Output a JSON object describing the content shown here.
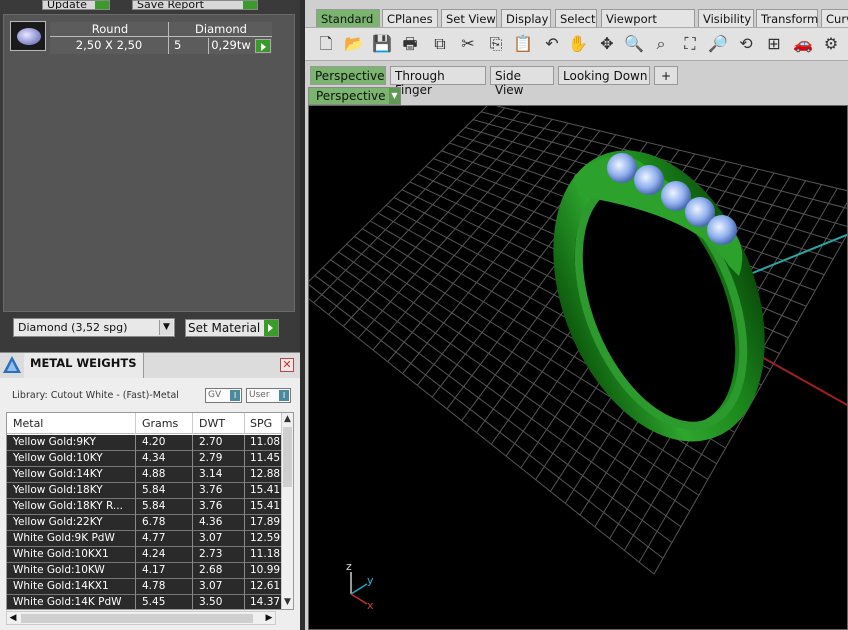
{
  "left": {
    "update_label": "Update",
    "save_report_label": "Save Report",
    "gem": {
      "header_shape": "Round",
      "header_stone": "Diamond",
      "size": "2,50 X 2,50",
      "count": "5",
      "weight": "0,29tw"
    },
    "material_select": "Diamond     (3,52 spg)",
    "set_material_label": "Set Material",
    "metal_weights_title": "METAL WEIGHTS",
    "close_label": "✕",
    "library_label": "Library: Cutout White - (Fast)-Metal",
    "toggle_gv": "GV",
    "toggle_user": "User",
    "table": {
      "columns": [
        "Metal",
        "Grams",
        "DWT",
        "SPG"
      ],
      "rows": [
        [
          "Yellow Gold:9KY",
          "4.20",
          "2.70",
          "11.08"
        ],
        [
          "Yellow Gold:10KY",
          "4.34",
          "2.79",
          "11.45"
        ],
        [
          "Yellow Gold:14KY",
          "4.88",
          "3.14",
          "12.88"
        ],
        [
          "Yellow Gold:18KY",
          "5.84",
          "3.76",
          "15.41"
        ],
        [
          "Yellow Gold:18KY R...",
          "5.84",
          "3.76",
          "15.41"
        ],
        [
          "Yellow Gold:22KY",
          "6.78",
          "4.36",
          "17.89"
        ],
        [
          "White Gold:9K PdW",
          "4.77",
          "3.07",
          "12.59"
        ],
        [
          "White Gold:10KX1",
          "4.24",
          "2.73",
          "11.18"
        ],
        [
          "White Gold:10KW",
          "4.17",
          "2.68",
          "10.99"
        ],
        [
          "White Gold:14KX1",
          "4.78",
          "3.07",
          "12.61"
        ],
        [
          "White Gold:14K PdW",
          "5.45",
          "3.50",
          "14.37"
        ]
      ]
    }
  },
  "right": {
    "toolbar_tabs": [
      "Standard",
      "CPlanes",
      "Set View",
      "Display",
      "Select",
      "Viewport Layout",
      "Visibility",
      "Transform",
      "Curve"
    ],
    "viewport_tabs": [
      "Perspective",
      "Through Finger",
      "Side View",
      "Looking Down"
    ],
    "add_tab_label": "+",
    "viewport_title": "Perspective",
    "axis_z": "z",
    "axis_y": "y",
    "axis_x": "x"
  },
  "colors": {
    "accent_green": "#7ab46e",
    "go_green": "#3a9a2a",
    "ring_green": "#1f8a1f"
  }
}
